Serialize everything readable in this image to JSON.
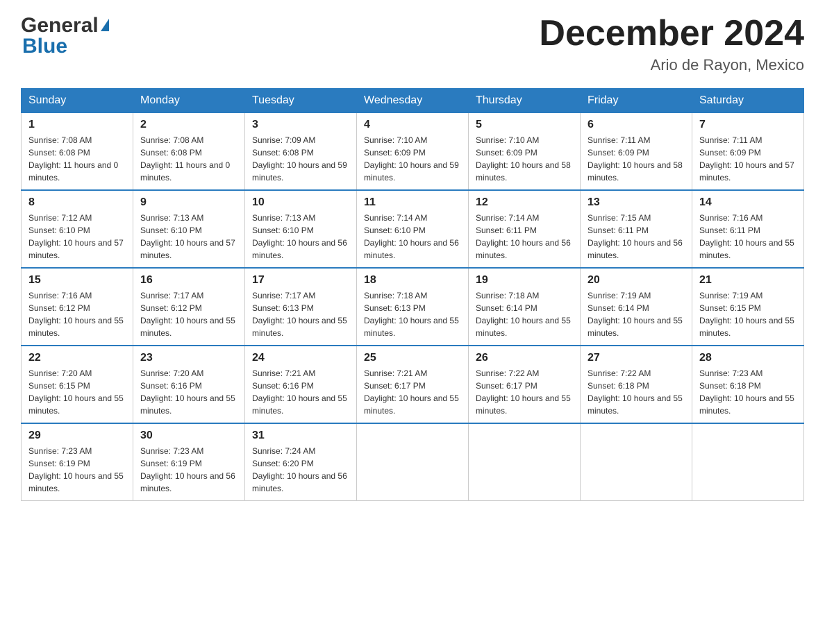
{
  "header": {
    "month_year": "December 2024",
    "location": "Ario de Rayon, Mexico",
    "logo_general": "General",
    "logo_blue": "Blue"
  },
  "days_of_week": [
    "Sunday",
    "Monday",
    "Tuesday",
    "Wednesday",
    "Thursday",
    "Friday",
    "Saturday"
  ],
  "weeks": [
    [
      {
        "day": "1",
        "sunrise": "7:08 AM",
        "sunset": "6:08 PM",
        "daylight": "11 hours and 0 minutes."
      },
      {
        "day": "2",
        "sunrise": "7:08 AM",
        "sunset": "6:08 PM",
        "daylight": "11 hours and 0 minutes."
      },
      {
        "day": "3",
        "sunrise": "7:09 AM",
        "sunset": "6:08 PM",
        "daylight": "10 hours and 59 minutes."
      },
      {
        "day": "4",
        "sunrise": "7:10 AM",
        "sunset": "6:09 PM",
        "daylight": "10 hours and 59 minutes."
      },
      {
        "day": "5",
        "sunrise": "7:10 AM",
        "sunset": "6:09 PM",
        "daylight": "10 hours and 58 minutes."
      },
      {
        "day": "6",
        "sunrise": "7:11 AM",
        "sunset": "6:09 PM",
        "daylight": "10 hours and 58 minutes."
      },
      {
        "day": "7",
        "sunrise": "7:11 AM",
        "sunset": "6:09 PM",
        "daylight": "10 hours and 57 minutes."
      }
    ],
    [
      {
        "day": "8",
        "sunrise": "7:12 AM",
        "sunset": "6:10 PM",
        "daylight": "10 hours and 57 minutes."
      },
      {
        "day": "9",
        "sunrise": "7:13 AM",
        "sunset": "6:10 PM",
        "daylight": "10 hours and 57 minutes."
      },
      {
        "day": "10",
        "sunrise": "7:13 AM",
        "sunset": "6:10 PM",
        "daylight": "10 hours and 56 minutes."
      },
      {
        "day": "11",
        "sunrise": "7:14 AM",
        "sunset": "6:10 PM",
        "daylight": "10 hours and 56 minutes."
      },
      {
        "day": "12",
        "sunrise": "7:14 AM",
        "sunset": "6:11 PM",
        "daylight": "10 hours and 56 minutes."
      },
      {
        "day": "13",
        "sunrise": "7:15 AM",
        "sunset": "6:11 PM",
        "daylight": "10 hours and 56 minutes."
      },
      {
        "day": "14",
        "sunrise": "7:16 AM",
        "sunset": "6:11 PM",
        "daylight": "10 hours and 55 minutes."
      }
    ],
    [
      {
        "day": "15",
        "sunrise": "7:16 AM",
        "sunset": "6:12 PM",
        "daylight": "10 hours and 55 minutes."
      },
      {
        "day": "16",
        "sunrise": "7:17 AM",
        "sunset": "6:12 PM",
        "daylight": "10 hours and 55 minutes."
      },
      {
        "day": "17",
        "sunrise": "7:17 AM",
        "sunset": "6:13 PM",
        "daylight": "10 hours and 55 minutes."
      },
      {
        "day": "18",
        "sunrise": "7:18 AM",
        "sunset": "6:13 PM",
        "daylight": "10 hours and 55 minutes."
      },
      {
        "day": "19",
        "sunrise": "7:18 AM",
        "sunset": "6:14 PM",
        "daylight": "10 hours and 55 minutes."
      },
      {
        "day": "20",
        "sunrise": "7:19 AM",
        "sunset": "6:14 PM",
        "daylight": "10 hours and 55 minutes."
      },
      {
        "day": "21",
        "sunrise": "7:19 AM",
        "sunset": "6:15 PM",
        "daylight": "10 hours and 55 minutes."
      }
    ],
    [
      {
        "day": "22",
        "sunrise": "7:20 AM",
        "sunset": "6:15 PM",
        "daylight": "10 hours and 55 minutes."
      },
      {
        "day": "23",
        "sunrise": "7:20 AM",
        "sunset": "6:16 PM",
        "daylight": "10 hours and 55 minutes."
      },
      {
        "day": "24",
        "sunrise": "7:21 AM",
        "sunset": "6:16 PM",
        "daylight": "10 hours and 55 minutes."
      },
      {
        "day": "25",
        "sunrise": "7:21 AM",
        "sunset": "6:17 PM",
        "daylight": "10 hours and 55 minutes."
      },
      {
        "day": "26",
        "sunrise": "7:22 AM",
        "sunset": "6:17 PM",
        "daylight": "10 hours and 55 minutes."
      },
      {
        "day": "27",
        "sunrise": "7:22 AM",
        "sunset": "6:18 PM",
        "daylight": "10 hours and 55 minutes."
      },
      {
        "day": "28",
        "sunrise": "7:23 AM",
        "sunset": "6:18 PM",
        "daylight": "10 hours and 55 minutes."
      }
    ],
    [
      {
        "day": "29",
        "sunrise": "7:23 AM",
        "sunset": "6:19 PM",
        "daylight": "10 hours and 55 minutes."
      },
      {
        "day": "30",
        "sunrise": "7:23 AM",
        "sunset": "6:19 PM",
        "daylight": "10 hours and 56 minutes."
      },
      {
        "day": "31",
        "sunrise": "7:24 AM",
        "sunset": "6:20 PM",
        "daylight": "10 hours and 56 minutes."
      },
      null,
      null,
      null,
      null
    ]
  ]
}
